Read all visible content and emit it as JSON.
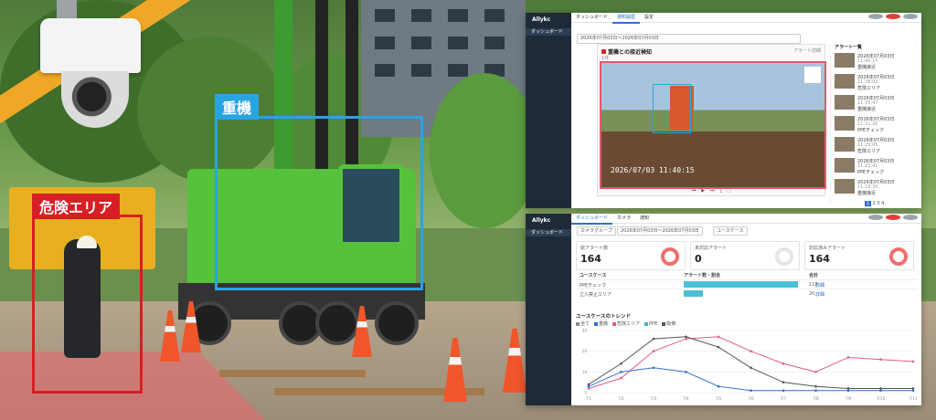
{
  "photo": {
    "tag_heavy": "重機",
    "tag_danger": "危険エリア"
  },
  "top_app": {
    "logo": "Allykc",
    "sidebar_nav": "ダッシュボード",
    "sidebar_footer": "ログ",
    "tabs": [
      "ダッシュボード",
      "通知履歴",
      "設定"
    ],
    "breadcrumb": "2026年07月03日 11:40:15",
    "filter_text": "2026年07月03日〜2026年07月03日",
    "video_title": "重機との接近検知",
    "video_meta": "1件",
    "video_right": "アラート詳細",
    "timestamp": "2026/07/03 11:40:15",
    "list_title": "アラート一覧",
    "list_items": [
      {
        "t1": "2026年07月03日",
        "t2": "11:40:15",
        "t3": "重機接近"
      },
      {
        "t1": "2026年07月03日",
        "t2": "11:38:02",
        "t3": "危険エリア"
      },
      {
        "t1": "2026年07月03日",
        "t2": "11:35:47",
        "t3": "重機接近"
      },
      {
        "t1": "2026年07月03日",
        "t2": "11:31:20",
        "t3": "PPEチェック"
      },
      {
        "t1": "2026年07月03日",
        "t2": "11:29:05",
        "t3": "危険エリア"
      },
      {
        "t1": "2026年07月03日",
        "t2": "11:22:41",
        "t3": "PPEチェック"
      },
      {
        "t1": "2026年07月03日",
        "t2": "11:18:30",
        "t3": "重機接近"
      }
    ],
    "pager": [
      "1",
      "2",
      "3",
      "4"
    ],
    "bottom_bar": "カメラ一覧"
  },
  "dashboard": {
    "logo": "Allykc",
    "sidebar_nav": "ダッシュボード",
    "tabs": [
      "ダッシュボード",
      "カメラ",
      "通知"
    ],
    "filters": [
      "カメラグループ",
      "2026年07月03日〜2026年07月03日",
      "ユースケース"
    ],
    "kpis": [
      {
        "label": "総アラート数",
        "value": "164"
      },
      {
        "label": "未対応アラート",
        "value": "0"
      },
      {
        "label": "対応済みアラート",
        "value": "164"
      }
    ],
    "table_headers": [
      "ユースケース",
      "アラート数・割合",
      "合計"
    ],
    "table_rows": [
      {
        "name": "PPEチェック",
        "value": 118,
        "link": "詳細"
      },
      {
        "name": "立入禁止エリア",
        "value": 20,
        "link": "詳細"
      }
    ],
    "trend_title": "ユースケースのトレンド",
    "legend": [
      {
        "label": "全て",
        "color": "#8a8a8a"
      },
      {
        "label": "重機",
        "color": "#2f6fd6"
      },
      {
        "label": "危険エリア",
        "color": "#e05a8a"
      },
      {
        "label": "PPE",
        "color": "#3fb6c9"
      },
      {
        "label": "転倒",
        "color": "#555555"
      }
    ]
  },
  "chart_data": {
    "type": "line",
    "x": [
      "7/1",
      "7/2",
      "7/3",
      "7/4",
      "7/5",
      "7/6",
      "7/7",
      "7/8",
      "7/9",
      "7/10",
      "7/11"
    ],
    "ylim": [
      0,
      30
    ],
    "yticks": [
      0,
      10,
      20,
      30
    ],
    "series": [
      {
        "color": "#e05a8a",
        "values": [
          2,
          7,
          20,
          26,
          27,
          20,
          14,
          10,
          17,
          16,
          15
        ]
      },
      {
        "color": "#555555",
        "values": [
          4,
          14,
          26,
          27,
          22,
          12,
          5,
          3,
          2,
          2,
          2
        ]
      },
      {
        "color": "#2f6fd6",
        "values": [
          3,
          10,
          12,
          10,
          3,
          1,
          1,
          1,
          1,
          1,
          1
        ]
      }
    ]
  }
}
